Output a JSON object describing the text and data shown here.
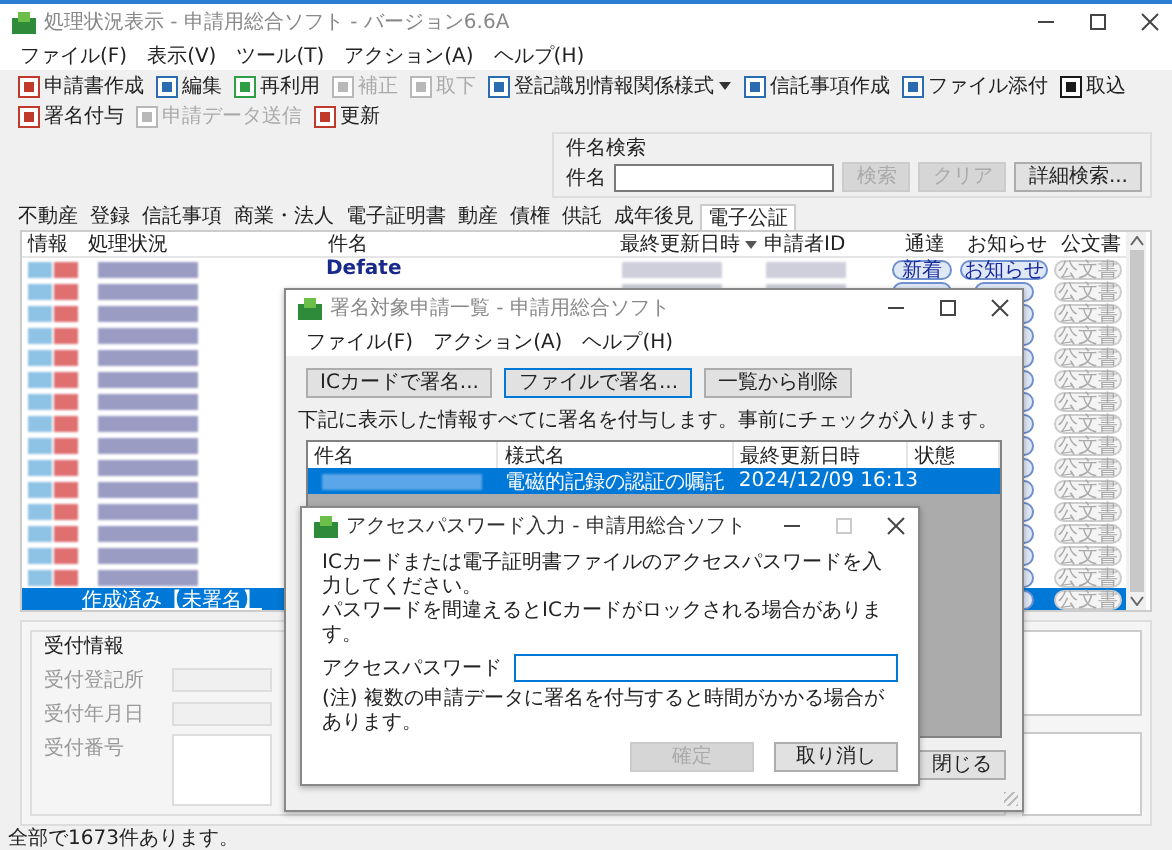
{
  "window": {
    "title": "処理状況表示 - 申請用総合ソフト - バージョン6.6A"
  },
  "menu": [
    "ファイル(F)",
    "表示(V)",
    "ツール(T)",
    "アクション(A)",
    "ヘルプ(H)"
  ],
  "toolbar": [
    {
      "label": "申請書作成",
      "disabled": false
    },
    {
      "label": "編集",
      "disabled": false
    },
    {
      "label": "再利用",
      "disabled": false
    },
    {
      "label": "補正",
      "disabled": true
    },
    {
      "label": "取下",
      "disabled": true
    },
    {
      "label": "登記識別情報関係様式",
      "disabled": false,
      "dropdown": true
    },
    {
      "label": "信託事項作成",
      "disabled": false
    },
    {
      "label": "ファイル添付",
      "disabled": false
    },
    {
      "label": "取込",
      "disabled": false
    },
    {
      "label": "署名付与",
      "disabled": false
    },
    {
      "label": "申請データ送信",
      "disabled": true
    },
    {
      "label": "更新",
      "disabled": false
    }
  ],
  "search": {
    "title": "件名検索",
    "label": "件名",
    "buttons": [
      {
        "label": "検索",
        "disabled": true
      },
      {
        "label": "クリア",
        "disabled": true
      },
      {
        "label": "詳細検索...",
        "disabled": false
      }
    ]
  },
  "tabs": [
    {
      "label": "不動産",
      "selected": false
    },
    {
      "label": "登録",
      "selected": false
    },
    {
      "label": "信託事項",
      "selected": false
    },
    {
      "label": "商業・法人",
      "selected": false
    },
    {
      "label": "電子証明書",
      "selected": false
    },
    {
      "label": "動産",
      "selected": false
    },
    {
      "label": "債権",
      "selected": false
    },
    {
      "label": "供託",
      "selected": false
    },
    {
      "label": "成年後見",
      "selected": false
    },
    {
      "label": "電子公証",
      "selected": true
    }
  ],
  "table": {
    "columns": [
      "情報",
      "処理状況",
      "件名",
      "最終更新日時",
      "申請者ID",
      "通達",
      "お知らせ",
      "公文書"
    ],
    "rows": [
      {
        "selected": false,
        "subject": "Defate",
        "notice": "新着",
        "news": "お知らせ",
        "official": "公文書"
      },
      {
        "selected": false,
        "official": "公文書"
      },
      {
        "selected": false,
        "official": "公文書"
      },
      {
        "selected": false,
        "official": "公文書"
      },
      {
        "selected": false,
        "official": "公文書"
      },
      {
        "selected": false,
        "official": "公文書"
      },
      {
        "selected": false,
        "official": "公文書"
      },
      {
        "selected": false,
        "official": "公文書"
      },
      {
        "selected": false,
        "official": "公文書"
      },
      {
        "selected": false,
        "official": "公文書"
      },
      {
        "selected": false,
        "official": "公文書"
      },
      {
        "selected": false,
        "official": "公文書"
      },
      {
        "selected": false,
        "official": "公文書"
      },
      {
        "selected": false,
        "official": "公文書"
      },
      {
        "selected": false,
        "official": "公文書"
      },
      {
        "selected": true,
        "status": "作成済み【未署名】",
        "official": "公文書"
      }
    ]
  },
  "reception": {
    "title": "受付情報",
    "fields": [
      {
        "label": "受付登記所",
        "disabled": true
      },
      {
        "label": "受付年月日",
        "disabled": true
      },
      {
        "label": "受付番号",
        "disabled": true
      }
    ]
  },
  "status_bar": "全部で1673件あります。",
  "sign_dialog": {
    "title": "署名対象申請一覧 - 申請用総合ソフト",
    "menu": [
      "ファイル(F)",
      "アクション(A)",
      "ヘルプ(H)"
    ],
    "buttons": [
      {
        "label": "ICカードで署名...",
        "focused": false
      },
      {
        "label": "ファイルで署名...",
        "focused": true
      },
      {
        "label": "一覧から削除",
        "focused": false
      }
    ],
    "instruction": "下記に表示した情報すべてに署名を付与します。事前にチェックが入ります。",
    "list": {
      "columns": [
        "件名",
        "様式名",
        "最終更新日時",
        "状態"
      ],
      "rows": [
        {
          "selected": true,
          "form": "電磁的記録の認証の嘱託",
          "updated": "2024/12/09 16:13"
        }
      ]
    },
    "close_button": "閉じる"
  },
  "password_dialog": {
    "title": "アクセスパスワード入力 - 申請用総合ソフト",
    "messages": [
      "ICカードまたは電子証明書ファイルのアクセスパスワードを入力してください。",
      "パスワードを間違えるとICカードがロックされる場合があります。"
    ],
    "field_label": "アクセスパスワード",
    "note": "(注) 複数の申請データに署名を付与すると時間がかかる場合があります。",
    "buttons": [
      {
        "label": "確定",
        "disabled": true
      },
      {
        "label": "取り消し",
        "disabled": false
      }
    ]
  }
}
